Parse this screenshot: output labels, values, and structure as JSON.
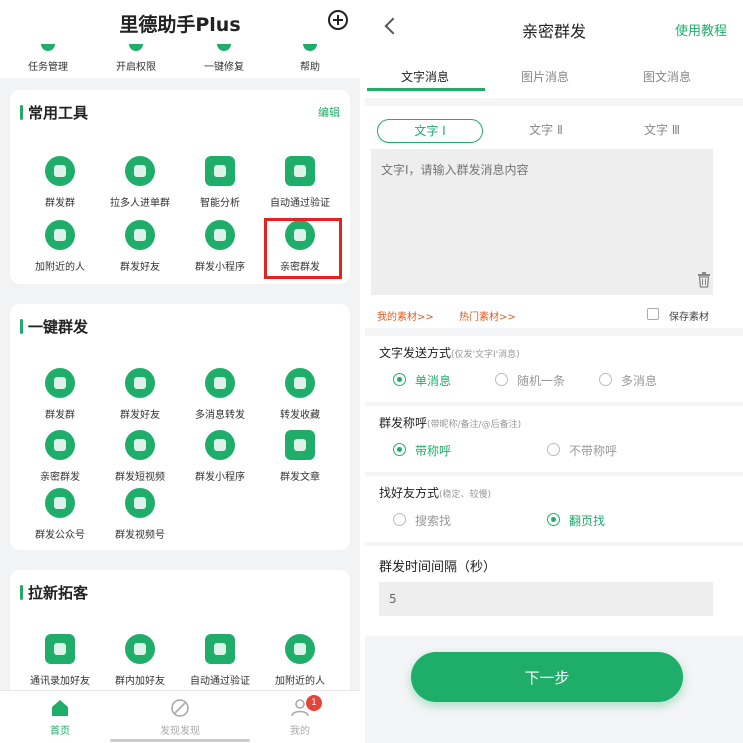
{
  "left": {
    "app_title": "里德助手Plus",
    "quick_actions": [
      "任务管理",
      "开启权限",
      "一键修复",
      "帮助"
    ],
    "common_tools": {
      "title": "常用工具",
      "edit": "编辑",
      "items": [
        "群发群",
        "拉多人进单群",
        "智能分析",
        "自动通过验证",
        "加附近的人",
        "群发好友",
        "群发小程序",
        "亲密群发"
      ]
    },
    "one_click": {
      "title": "一键群发",
      "items": [
        "群发群",
        "群发好友",
        "多消息转发",
        "转发收藏",
        "亲密群发",
        "群发短视频",
        "群发小程序",
        "群发文章",
        "群发公众号",
        "群发视频号"
      ]
    },
    "growth": {
      "title": "拉新拓客",
      "items": [
        "通讯录加好友",
        "群内加好友",
        "自动通过验证",
        "加附近的人"
      ]
    },
    "tabbar": {
      "home": "首页",
      "discover": "发现发现",
      "mine": "我的",
      "badge": "1"
    }
  },
  "right": {
    "title": "亲密群发",
    "tutorial": "使用教程",
    "tabs": [
      "文字消息",
      "图片消息",
      "图文消息"
    ],
    "sub_tabs": [
      "文字 Ⅰ",
      "文字 Ⅱ",
      "文字 Ⅲ"
    ],
    "textarea_placeholder": "文字Ⅰ，请输入群发消息内容",
    "my_material": "我的素材>>",
    "hot_material": "热门素材>>",
    "save_material": "保存素材",
    "send_mode": {
      "title": "文字发送方式",
      "hint": "(仅发'文字Ⅰ'消息)",
      "options": [
        "单消息",
        "随机一条",
        "多消息"
      ]
    },
    "salutation": {
      "title": "群发称呼",
      "hint": "(带昵称/备注/@后备注)",
      "options": [
        "带称呼",
        "不带称呼"
      ]
    },
    "find_mode": {
      "title": "找好友方式",
      "hint": "(稳定、较慢)",
      "options": [
        "搜索找",
        "翻页找"
      ]
    },
    "interval": {
      "title": "群发时间间隔（秒）",
      "value": "5"
    },
    "next": "下一步"
  },
  "colors": {
    "accent": "#1fae6a",
    "highlight": "#e32222",
    "link_orange": "#e55a1c"
  }
}
